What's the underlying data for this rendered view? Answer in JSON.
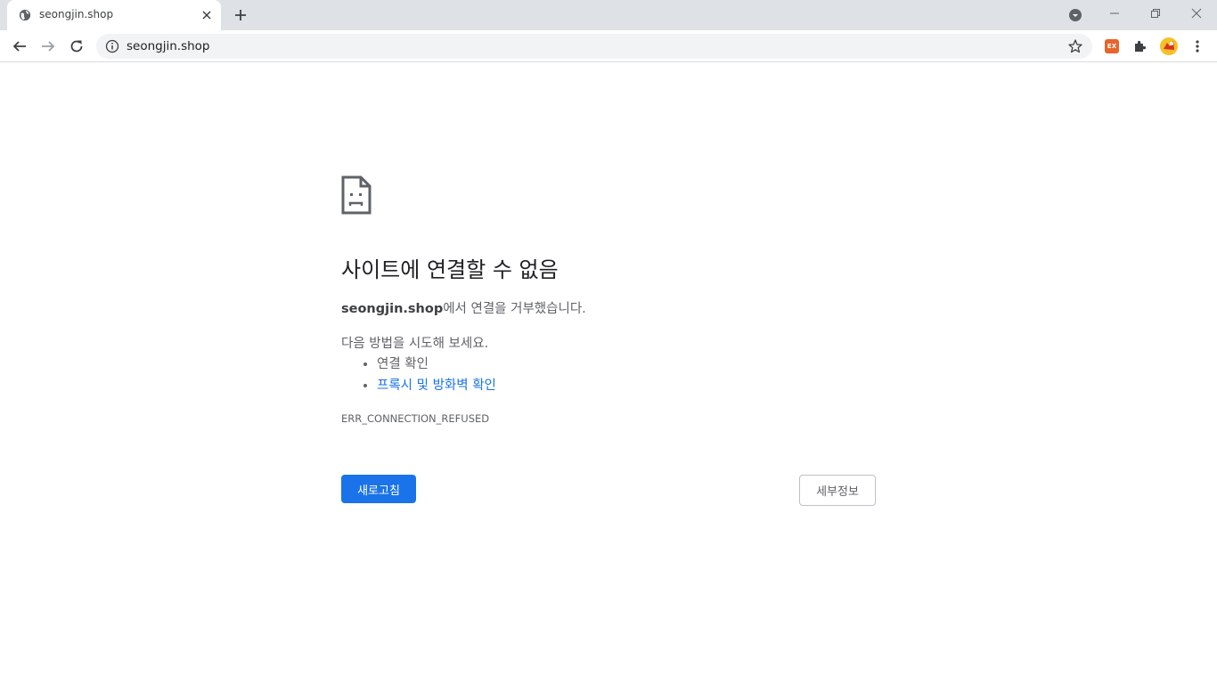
{
  "browser": {
    "tab": {
      "title": "seongjin.shop"
    },
    "omnibox": {
      "url": "seongjin.shop"
    },
    "extensions": {
      "ex_label": "EX"
    }
  },
  "error_page": {
    "heading": "사이트에 연결할 수 없음",
    "description_host": "seongjin.shop",
    "description_rest": "에서 연결을 거부했습니다.",
    "try_label": "다음 방법을 시도해 보세요.",
    "suggestions": [
      {
        "text": "연결 확인",
        "is_link": false
      },
      {
        "text": "프록시 및 방화벽 확인",
        "is_link": true
      }
    ],
    "error_code": "ERR_CONNECTION_REFUSED",
    "reload_label": "새로고침",
    "details_label": "세부정보"
  },
  "colors": {
    "tabstrip_bg": "#dee1e6",
    "omnibox_bg": "#f1f3f4",
    "primary_button": "#1a73e8",
    "link": "#1a73e8",
    "body_text": "#5f6368",
    "heading_text": "#202124"
  }
}
